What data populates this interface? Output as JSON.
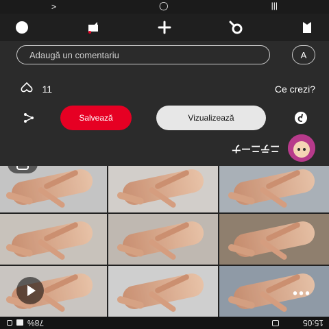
{
  "status": {
    "time": "15:05",
    "battery": "78%"
  },
  "pin": {
    "author": {
      "name": "ニテニーナ"
    },
    "comments": {
      "prompt": "Ce crezi?",
      "likes": "11"
    },
    "comment": {
      "avatar_initial": "A",
      "placeholder": "Adaugă un comentariu"
    },
    "buttons": {
      "view": "Vizualizează",
      "save": "Salvează"
    }
  },
  "colors": {
    "save": "#e60023",
    "view": "#e7e7e7",
    "page": "#2b2b2b"
  }
}
